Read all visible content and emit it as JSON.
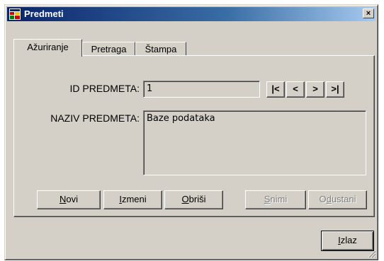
{
  "window": {
    "title": "Predmeti",
    "close_glyph": "×"
  },
  "tabs": [
    {
      "label": "Ažuriranje",
      "active": true
    },
    {
      "label": "Pretraga",
      "active": false
    },
    {
      "label": "Štampa",
      "active": false
    }
  ],
  "form": {
    "id_label": "ID PREDMETA:",
    "id_value": "1",
    "naziv_label": "NAZIV PREDMETA:",
    "naziv_value": "Baze podataka"
  },
  "nav": {
    "first": "|<",
    "prev": "<",
    "next": ">",
    "last": ">|"
  },
  "actions": {
    "novi": {
      "accel": "N",
      "rest": "ovi"
    },
    "izmeni": {
      "accel": "I",
      "rest": "zmeni"
    },
    "obrisi": {
      "accel": "O",
      "rest": "briši"
    },
    "snimi": {
      "accel": "S",
      "rest": "nimi",
      "enabled": false
    },
    "odustani": {
      "pre": "O",
      "accel": "d",
      "rest": "ustani",
      "enabled": false
    }
  },
  "footer": {
    "izlaz": {
      "accel": "I",
      "rest": "zlaz"
    }
  },
  "icons": {
    "app": "form-app-icon",
    "close": "close-icon",
    "grip": "resize-grip-icon"
  }
}
